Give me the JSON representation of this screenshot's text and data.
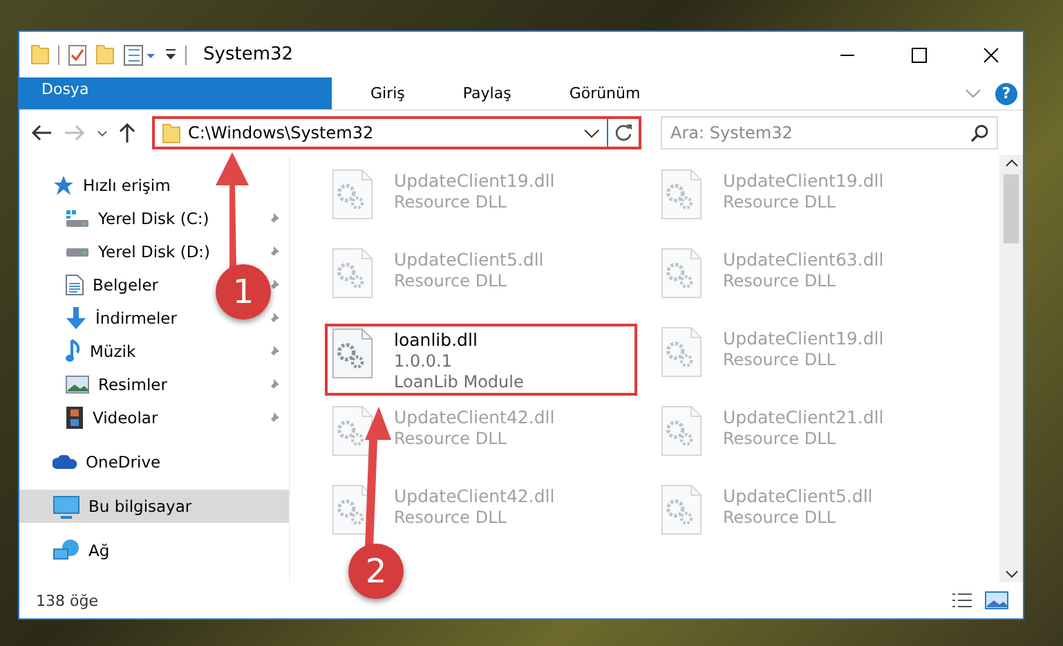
{
  "window": {
    "title": "System32"
  },
  "ribbon_tabs": [
    {
      "label": "Dosya",
      "kind": "file",
      "selected": false
    },
    {
      "label": "Giriş",
      "kind": "tab",
      "selected": false
    },
    {
      "label": "Paylaş",
      "kind": "tab",
      "selected": false
    },
    {
      "label": "Görünüm",
      "kind": "tab",
      "selected": false
    }
  ],
  "help_button": {
    "label": "?"
  },
  "address_bar": {
    "path": "C:\\Windows\\System32",
    "highlighted": true
  },
  "search": {
    "placeholder": "Ara: System32"
  },
  "sidebar": {
    "items": [
      {
        "label": "Hızlı erişim",
        "selected": false,
        "children": [
          {
            "label": "Yerel Disk (C:)",
            "pinned": true,
            "selected": false
          },
          {
            "label": "Yerel Disk (D:)",
            "pinned": true,
            "selected": false
          },
          {
            "label": "Belgeler",
            "pinned": true,
            "selected": false
          },
          {
            "label": "İndirmeler",
            "pinned": true,
            "selected": false
          },
          {
            "label": "Müzik",
            "pinned": true,
            "selected": false
          },
          {
            "label": "Resimler",
            "pinned": true,
            "selected": false
          },
          {
            "label": "Videolar",
            "pinned": true,
            "selected": false
          }
        ]
      },
      {
        "label": "OneDrive",
        "selected": false
      },
      {
        "label": "Bu bilgisayar",
        "selected": true
      },
      {
        "label": "Ağ",
        "selected": false
      }
    ]
  },
  "files": [
    {
      "name": "UpdateClient19.dll",
      "description": "Resource DLL",
      "dimmed": true,
      "highlighted": false
    },
    {
      "name": "UpdateClient19.dll",
      "description": "Resource DLL",
      "dimmed": true,
      "highlighted": false
    },
    {
      "name": "UpdateClient5.dll",
      "description": "Resource DLL",
      "dimmed": true,
      "highlighted": false
    },
    {
      "name": "UpdateClient63.dll",
      "description": "Resource DLL",
      "dimmed": true,
      "highlighted": false
    },
    {
      "name": "loanlib.dll",
      "version": "1.0.0.1",
      "description": "LoanLib Module",
      "dimmed": false,
      "highlighted": true
    },
    {
      "name": "UpdateClient19.dll",
      "description": "Resource DLL",
      "dimmed": true,
      "highlighted": false
    },
    {
      "name": "UpdateClient42.dll",
      "description": "Resource DLL",
      "dimmed": true,
      "highlighted": false
    },
    {
      "name": "UpdateClient21.dll",
      "description": "Resource DLL",
      "dimmed": true,
      "highlighted": false
    },
    {
      "name": "UpdateClient42.dll",
      "description": "Resource DLL",
      "dimmed": true,
      "highlighted": false
    },
    {
      "name": "UpdateClient5.dll",
      "description": "Resource DLL",
      "dimmed": true,
      "highlighted": false
    }
  ],
  "status_bar": {
    "item_count": "138 öğe"
  },
  "annotations": [
    {
      "label": "1"
    },
    {
      "label": "2"
    }
  ]
}
